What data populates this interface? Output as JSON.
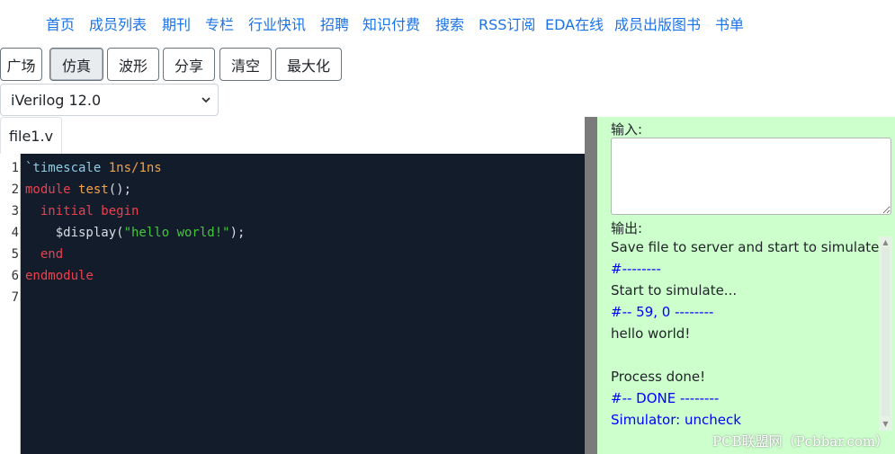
{
  "nav": {
    "items": [
      "首页",
      "成员列表",
      "期刊",
      "专栏",
      "行业快讯",
      "招聘",
      "知识付费",
      "搜索",
      "RSS订阅",
      "EDA在线",
      "成员出版图书",
      "书单"
    ]
  },
  "toolbar": {
    "buttons": [
      "广场",
      "仿真",
      "波形",
      "分享",
      "清空",
      "最大化"
    ],
    "active": "仿真"
  },
  "simulator_select": {
    "value": "iVerilog 12.0"
  },
  "tabs": [
    {
      "label": "file1.v"
    }
  ],
  "editor": {
    "line_numbers": [
      "1",
      "2",
      "3",
      "4",
      "5",
      "6",
      "7"
    ],
    "lines": [
      [
        {
          "t": "`timescale",
          "c": "dir"
        },
        {
          "t": " 1ns/1ns",
          "c": "id"
        }
      ],
      [
        {
          "t": "module",
          "c": "kw"
        },
        {
          "t": " ",
          "c": "plain"
        },
        {
          "t": "test",
          "c": "id"
        },
        {
          "t": "();",
          "c": "plain"
        }
      ],
      [
        {
          "t": "  initial",
          "c": "kw"
        },
        {
          "t": " ",
          "c": "plain"
        },
        {
          "t": "begin",
          "c": "kw"
        }
      ],
      [
        {
          "t": "    $display(",
          "c": "plain"
        },
        {
          "t": "\"hello world!\"",
          "c": "str"
        },
        {
          "t": ");",
          "c": "plain"
        }
      ],
      [
        {
          "t": "  end",
          "c": "kw"
        }
      ],
      [
        {
          "t": "endmodule",
          "c": "kw"
        }
      ],
      []
    ]
  },
  "panel": {
    "input_label": "输入:",
    "input_value": "",
    "output_label": "输出:",
    "output_lines": [
      {
        "text": "Save file to server and start to simulate...",
        "kind": "msg"
      },
      {
        "text": "#--------",
        "kind": "sys"
      },
      {
        "text": "Start to simulate...",
        "kind": "msg"
      },
      {
        "text": "#-- 59, 0 --------",
        "kind": "sys"
      },
      {
        "text": "hello world!",
        "kind": "msg"
      },
      {
        "text": "",
        "kind": "msg"
      },
      {
        "text": "Process done!",
        "kind": "msg"
      },
      {
        "text": "#-- DONE --------",
        "kind": "sys"
      },
      {
        "text": "Simulator: uncheck",
        "kind": "sys"
      }
    ]
  },
  "watermark": "PCB联盟网（Pcbbar.com）",
  "colors": {
    "link": "#1a73e8",
    "editor_bg": "#131c2b",
    "panel_bg": "#ccffcc",
    "keyword": "#e8424f",
    "identifier": "#f3a246",
    "string": "#46c43f",
    "system_output": "#0000ff"
  }
}
